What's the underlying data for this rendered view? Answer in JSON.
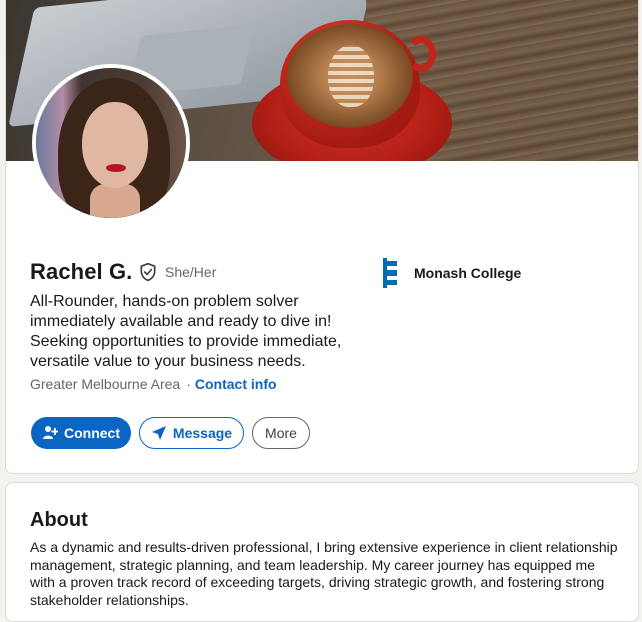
{
  "profile": {
    "name": "Rachel G.",
    "pronouns": "She/Her",
    "headline": "All-Rounder, hands-on problem solver immediately available and ready to dive in! Seeking opportunities to provide immediate, versatile value to your business needs.",
    "location": "Greater Melbourne Area",
    "separator": "·",
    "contact_label": "Contact info"
  },
  "education": {
    "school_name": "Monash College"
  },
  "actions": {
    "connect_label": "Connect",
    "message_label": "Message",
    "more_label": "More"
  },
  "about": {
    "title": "About",
    "text": "As a dynamic and results-driven professional, I bring extensive experience in client relationship management, strategic planning, and team leadership. My career journey has equipped me with a proven track record of exceeding targets, driving strategic growth, and fostering strong stakeholder relationships."
  },
  "colors": {
    "accent": "#0a66c2",
    "text": "#191919",
    "muted": "#666666",
    "page_bg": "#f4f2ee"
  },
  "icons": {
    "verified": "verified-shield-icon",
    "connect": "add-person-icon",
    "message": "send-paper-plane-icon",
    "school": "monash-college-logo"
  }
}
